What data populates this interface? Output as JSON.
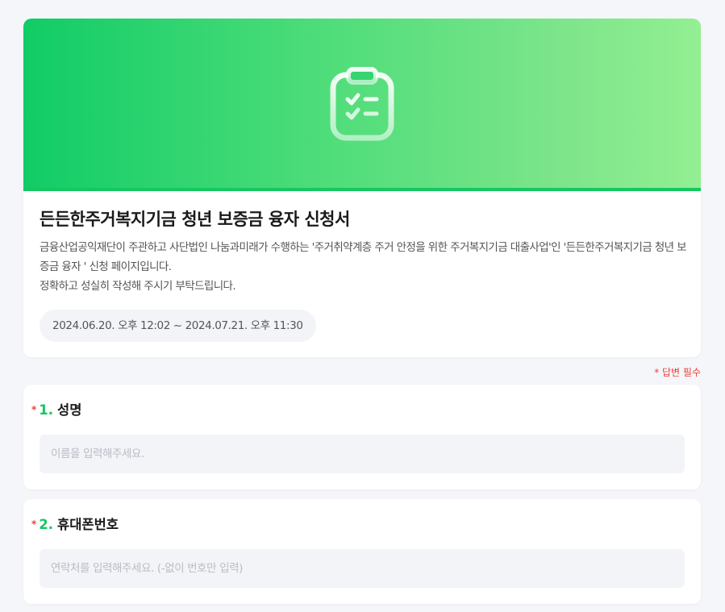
{
  "form": {
    "title": "든든한주거복지기금 청년 보증금 융자 신청서",
    "description_line1": "금융산업공익재단이 주관하고 사단법인 나눔과미래가 수행하는 '주거취약계층 주거 안정을 위한 주거복지기금 대출사업'인 '든든한주거복지기금 청년 보증금 융자 ' 신청 페이지입니다.",
    "description_line2": "정확하고 성실히 작성해 주시기 부탁드립니다.",
    "period": "2024.06.20. 오후 12:02 ~ 2024.07.21. 오후 11:30",
    "banner_icon": "clipboard-check-icon"
  },
  "required_note": "* 답변 필수",
  "questions": [
    {
      "star": "*",
      "number": "1.",
      "label": "성명",
      "value": "",
      "placeholder": "이름을 입력해주세요."
    },
    {
      "star": "*",
      "number": "2.",
      "label": "휴대폰번호",
      "value": "",
      "placeholder": "연락처를 입력해주세요. (-없이 번호만 입력)"
    }
  ],
  "colors": {
    "accent": "#15c760",
    "required": "#e8443a",
    "background": "#f5f6fa"
  }
}
